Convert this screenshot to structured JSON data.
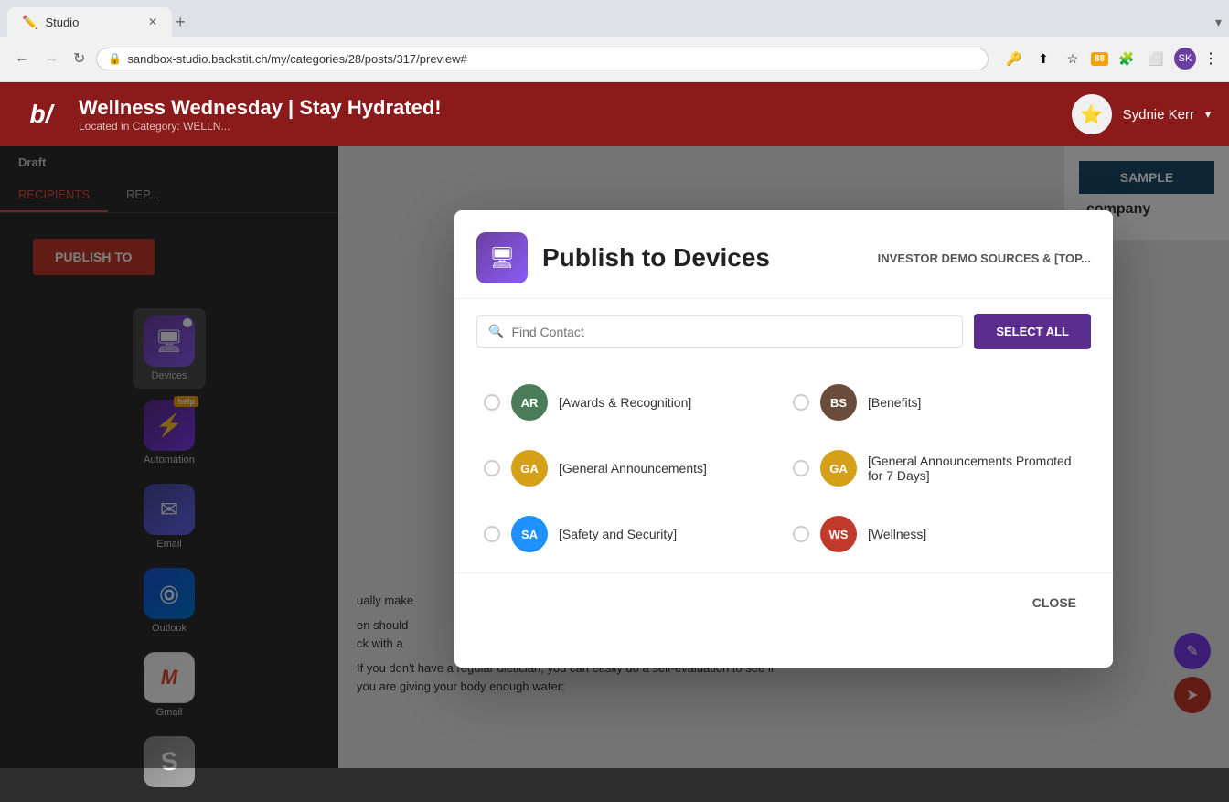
{
  "browser": {
    "tab_label": "Studio",
    "tab_icon": "✏️",
    "url": "sandbox-studio.backstit.ch/my/categories/28/posts/317/preview#",
    "new_tab_icon": "+",
    "dropdown_icon": "▾"
  },
  "app": {
    "logo_text": "b/",
    "title": "Wellness Wednesday | Stay Hydrated!",
    "subtitle": "Located in Category: WELLN...",
    "user_name": "Sydnie Kerr",
    "draft_label": "Draft"
  },
  "nav_tabs": {
    "recipients_label": "RECIPIENTS",
    "rep_label": "REP..."
  },
  "publish_to_btn": "PUBLISH TO",
  "sidebar_items": [
    {
      "id": "devices",
      "label": "Devices",
      "icon": "🖥",
      "active": true
    },
    {
      "id": "automation",
      "label": "Automation",
      "icon": "⚡",
      "active": false
    },
    {
      "id": "email",
      "label": "Email",
      "icon": "✉",
      "active": false
    },
    {
      "id": "outlook",
      "label": "Outlook",
      "icon": "Ⓞ",
      "active": false
    },
    {
      "id": "gmail",
      "label": "Gmail",
      "icon": "M",
      "active": false
    },
    {
      "id": "letter",
      "label": "S",
      "active": false
    }
  ],
  "modal": {
    "title": "Publish to Devices",
    "icon": "🖥",
    "source_label": "INVESTOR DEMO SOURCES & [TOP...",
    "search_placeholder": "Find Contact",
    "select_all_label": "SELECT ALL",
    "close_label": "CLOSE",
    "contacts": [
      {
        "id": "ar",
        "initials": "AR",
        "label": "[Awards & Recognition]",
        "color": "#4a7c59"
      },
      {
        "id": "bs",
        "initials": "BS",
        "label": "[Benefits]",
        "color": "#6b4c3b"
      },
      {
        "id": "ga1",
        "initials": "GA",
        "label": "[General Announcements]",
        "color": "#d4a017"
      },
      {
        "id": "ga2",
        "initials": "GA",
        "label": "[General Announcements Promoted for 7 Days]",
        "color": "#d4a017"
      },
      {
        "id": "sa",
        "initials": "SA",
        "label": "[Safety and Security]",
        "color": "#1e90ff"
      },
      {
        "id": "ws",
        "initials": "WS",
        "label": "[Wellness]",
        "color": "#c0392b"
      }
    ]
  },
  "preview": {
    "sample_label": "SAMPLE",
    "company_label": "company"
  },
  "scroll_buttons": {
    "edit_icon": "✎",
    "send_icon": "➤"
  }
}
